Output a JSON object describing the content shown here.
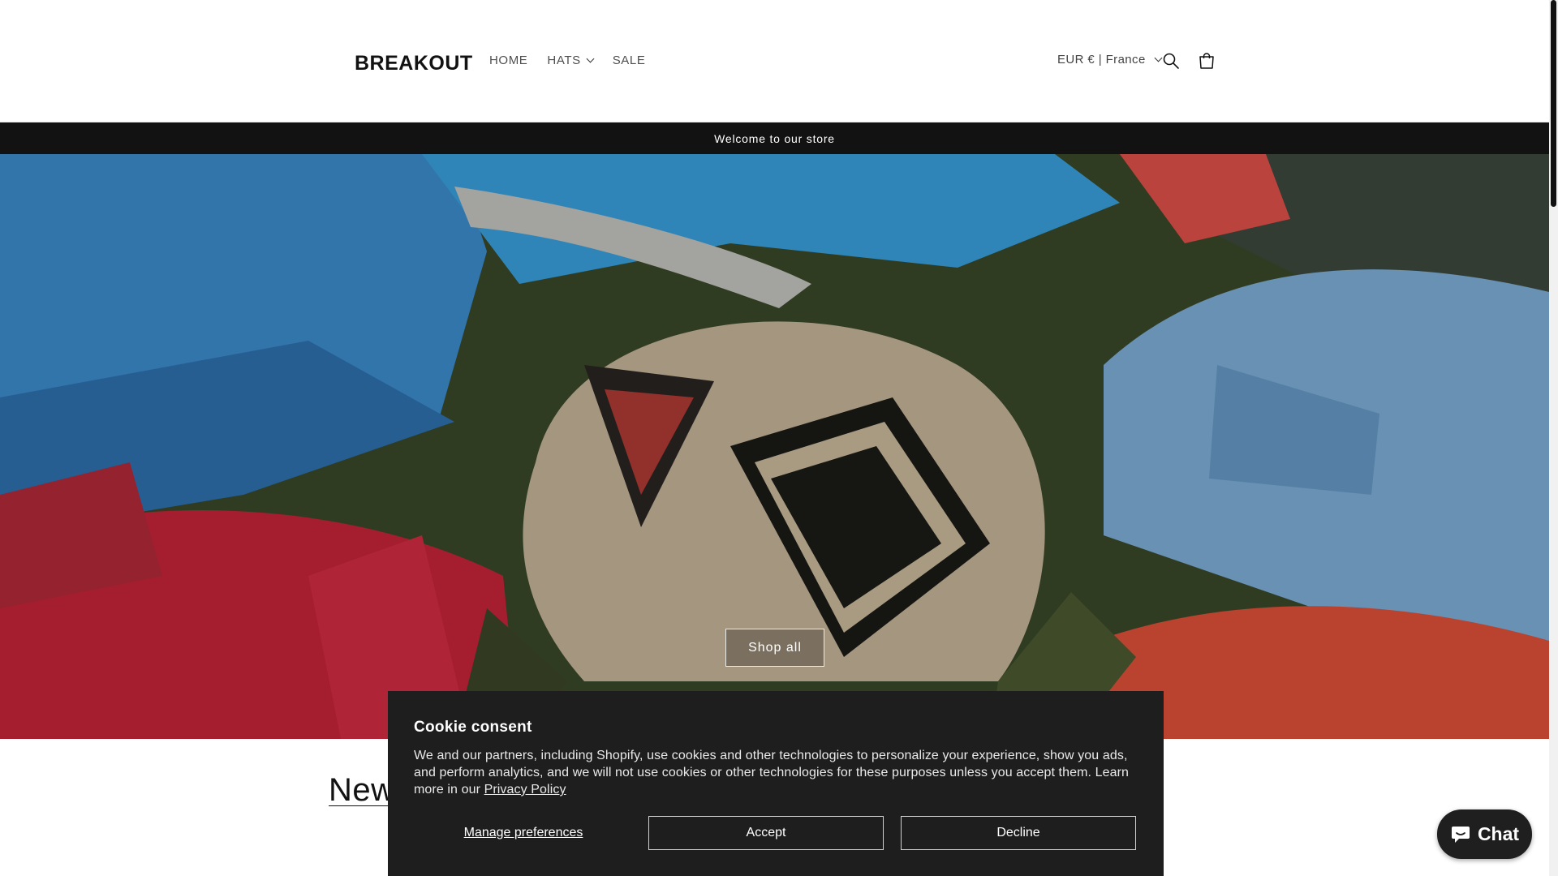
{
  "header": {
    "logo": "BREAKOUT",
    "nav": [
      {
        "label": "HOME"
      },
      {
        "label": "HATS",
        "has_dropdown": true
      },
      {
        "label": "SALE"
      }
    ],
    "currency": "EUR € | France",
    "icons": [
      "search-icon",
      "cart-icon"
    ]
  },
  "announcement": {
    "text": "Welcome to our store"
  },
  "hero": {
    "cta_label": "Shop all"
  },
  "section": {
    "title_visible": "New"
  },
  "cookie": {
    "title": "Cookie consent",
    "body": "We and our partners, including Shopify, use cookies and other technologies to personalize your experience, show you ads, and perform analytics, and we will not use cookies or other technologies for these purposes unless you accept them. Learn more in our ",
    "link_label": "Privacy Policy",
    "manage_label": "Manage preferences",
    "accept_label": "Accept",
    "decline_label": "Decline"
  },
  "chat": {
    "label": "Chat"
  },
  "colors": {
    "announcement_bg": "#121212",
    "cookie_bg": "#1e1e1e",
    "chat_bg": "#1f1f1f"
  }
}
